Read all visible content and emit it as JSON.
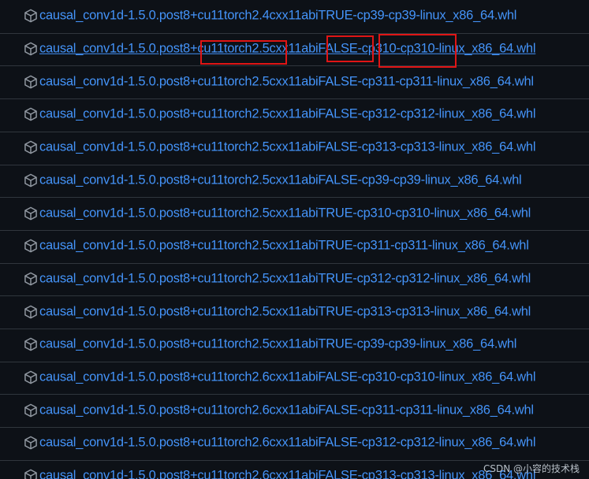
{
  "assets": [
    {
      "name": "causal_conv1d-1.5.0.post8+cu11torch2.4cxx11abiTRUE-cp39-cp39-linux_x86_64.whl",
      "icon": "package-icon"
    },
    {
      "name": "causal_conv1d-1.5.0.post8+cu11torch2.5cxx11abiFALSE-cp310-cp310-linux_x86_64.whl",
      "icon": "package-icon",
      "hovered": true
    },
    {
      "name": "causal_conv1d-1.5.0.post8+cu11torch2.5cxx11abiFALSE-cp311-cp311-linux_x86_64.whl",
      "icon": "package-icon"
    },
    {
      "name": "causal_conv1d-1.5.0.post8+cu11torch2.5cxx11abiFALSE-cp312-cp312-linux_x86_64.whl",
      "icon": "package-icon"
    },
    {
      "name": "causal_conv1d-1.5.0.post8+cu11torch2.5cxx11abiFALSE-cp313-cp313-linux_x86_64.whl",
      "icon": "package-icon"
    },
    {
      "name": "causal_conv1d-1.5.0.post8+cu11torch2.5cxx11abiFALSE-cp39-cp39-linux_x86_64.whl",
      "icon": "package-icon"
    },
    {
      "name": "causal_conv1d-1.5.0.post8+cu11torch2.5cxx11abiTRUE-cp310-cp310-linux_x86_64.whl",
      "icon": "package-icon"
    },
    {
      "name": "causal_conv1d-1.5.0.post8+cu11torch2.5cxx11abiTRUE-cp311-cp311-linux_x86_64.whl",
      "icon": "package-icon"
    },
    {
      "name": "causal_conv1d-1.5.0.post8+cu11torch2.5cxx11abiTRUE-cp312-cp312-linux_x86_64.whl",
      "icon": "package-icon"
    },
    {
      "name": "causal_conv1d-1.5.0.post8+cu11torch2.5cxx11abiTRUE-cp313-cp313-linux_x86_64.whl",
      "icon": "package-icon"
    },
    {
      "name": "causal_conv1d-1.5.0.post8+cu11torch2.5cxx11abiTRUE-cp39-cp39-linux_x86_64.whl",
      "icon": "package-icon"
    },
    {
      "name": "causal_conv1d-1.5.0.post8+cu11torch2.6cxx11abiFALSE-cp310-cp310-linux_x86_64.whl",
      "icon": "package-icon"
    },
    {
      "name": "causal_conv1d-1.5.0.post8+cu11torch2.6cxx11abiFALSE-cp311-cp311-linux_x86_64.whl",
      "icon": "package-icon"
    },
    {
      "name": "causal_conv1d-1.5.0.post8+cu11torch2.6cxx11abiFALSE-cp312-cp312-linux_x86_64.whl",
      "icon": "package-icon"
    },
    {
      "name": "causal_conv1d-1.5.0.post8+cu11torch2.6cxx11abiFALSE-cp313-cp313-linux_x86_64.whl",
      "icon": "package-icon"
    }
  ],
  "annotations": {
    "color": "#e01515",
    "boxes": [
      "cu11torch2.5",
      "FALSE",
      "cp310-cp310"
    ]
  },
  "watermark": "CSDN @小容的技术栈",
  "colors": {
    "background": "#0d1117",
    "link": "#4493f8",
    "icon": "#9198a1",
    "divider": "#30363d"
  }
}
